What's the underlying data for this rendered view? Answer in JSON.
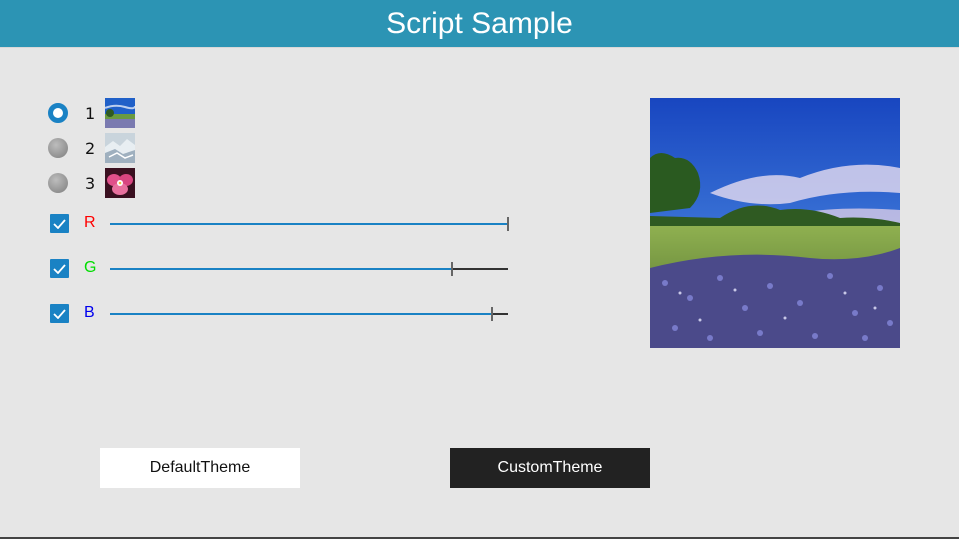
{
  "header": {
    "title": "Script Sample"
  },
  "radios": [
    {
      "label": "1",
      "selected": true,
      "thumb_icon": "field-thumbnail-icon"
    },
    {
      "label": "2",
      "selected": false,
      "thumb_icon": "snow-thumbnail-icon"
    },
    {
      "label": "3",
      "selected": false,
      "thumb_icon": "flower-thumbnail-icon"
    }
  ],
  "channels": [
    {
      "label": "R",
      "checked": true,
      "color": "#ff0000",
      "value": 1.0
    },
    {
      "label": "G",
      "checked": true,
      "color": "#00dd00",
      "value": 0.86
    },
    {
      "label": "B",
      "checked": true,
      "color": "#0000ee",
      "value": 0.96
    }
  ],
  "preview": {
    "icon": "landscape-preview-image"
  },
  "buttons": {
    "default_theme": "DefaultTheme",
    "custom_theme": "CustomTheme"
  },
  "colors": {
    "header": "#2c94b4",
    "accent": "#1a82c4",
    "background": "#e6e6e6"
  }
}
